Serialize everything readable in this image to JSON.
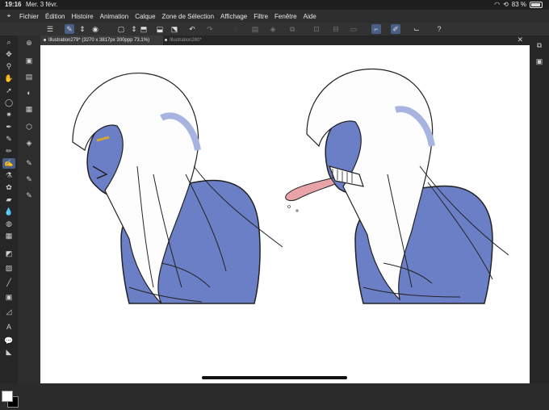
{
  "status": {
    "time": "19:16",
    "date": "Mer. 3 févr.",
    "battery": "83 %"
  },
  "menu": {
    "items": [
      "Fichier",
      "Édition",
      "Histoire",
      "Animation",
      "Calque",
      "Zone de Sélection",
      "Affichage",
      "Filtre",
      "Fenêtre",
      "Aide"
    ]
  },
  "tabs": [
    {
      "label": "Illustration279* (3270 x 3817px 300ppp 73.1%)",
      "active": true
    },
    {
      "label": "Illustration280*",
      "active": false
    }
  ],
  "colors": {
    "accent": "#4a5f85",
    "main_color": "#ffffff",
    "sub_color": "#000000",
    "skin": "#6b7fc6"
  }
}
